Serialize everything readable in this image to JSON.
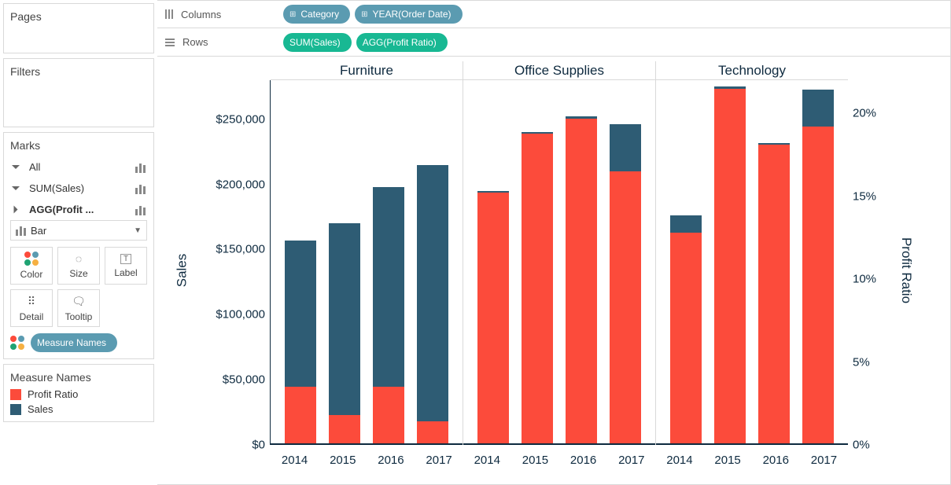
{
  "side": {
    "pages_title": "Pages",
    "filters_title": "Filters",
    "marks_title": "Marks",
    "marks_items": {
      "all": "All",
      "sum_sales": "SUM(Sales)",
      "agg_profit": "AGG(Profit ..."
    },
    "mark_type": "Bar",
    "cells": {
      "color": "Color",
      "size": "Size",
      "label": "Label",
      "detail": "Detail",
      "tooltip": "Tooltip"
    },
    "measure_names_pill": "Measure Names",
    "legend_title": "Measure Names",
    "legend": {
      "profit": "Profit Ratio",
      "sales": "Sales"
    }
  },
  "shelves": {
    "columns_label": "Columns",
    "rows_label": "Rows",
    "columns": [
      {
        "label": "Category",
        "expand": true
      },
      {
        "label": "YEAR(Order Date)",
        "expand": true
      }
    ],
    "rows": [
      {
        "label": "SUM(Sales)"
      },
      {
        "label": "AGG(Profit Ratio)"
      }
    ]
  },
  "chart_data": {
    "type": "bar",
    "stacking": "stacked",
    "categories": [
      "Furniture",
      "Office Supplies",
      "Technology"
    ],
    "years": [
      "2014",
      "2015",
      "2016",
      "2017"
    ],
    "y_left": {
      "label": "Sales",
      "ticks": [
        "$0",
        "$50,000",
        "$100,000",
        "$150,000",
        "$200,000",
        "$250,000"
      ],
      "max": 280000
    },
    "y_right": {
      "label": "Profit Ratio",
      "ticks": [
        "0%",
        "5%",
        "10%",
        "15%",
        "20%"
      ],
      "max": 0.22
    },
    "series_note": "Each bar total height encodes Sales on left axis; red segment height encodes Profit Ratio on right axis (mapped to same pixel space via Tableau dual-axis).",
    "data": {
      "Furniture": [
        {
          "year": "2014",
          "sales": 157000,
          "profit_ratio": 0.035
        },
        {
          "year": "2015",
          "sales": 170000,
          "profit_ratio": 0.018
        },
        {
          "year": "2016",
          "sales": 198000,
          "profit_ratio": 0.035
        },
        {
          "year": "2017",
          "sales": 215000,
          "profit_ratio": 0.014
        }
      ],
      "Office Supplies": [
        {
          "year": "2014",
          "sales": 195000,
          "profit_ratio": 0.152
        },
        {
          "year": "2015",
          "sales": 240000,
          "profit_ratio": 0.188
        },
        {
          "year": "2016",
          "sales": 252000,
          "profit_ratio": 0.197
        },
        {
          "year": "2017",
          "sales": 246000,
          "profit_ratio": 0.165
        }
      ],
      "Technology": [
        {
          "year": "2014",
          "sales": 176000,
          "profit_ratio": 0.128
        },
        {
          "year": "2015",
          "sales": 275000,
          "profit_ratio": 0.215
        },
        {
          "year": "2016",
          "sales": 232000,
          "profit_ratio": 0.181
        },
        {
          "year": "2017",
          "sales": 273000,
          "profit_ratio": 0.192
        }
      ]
    }
  }
}
